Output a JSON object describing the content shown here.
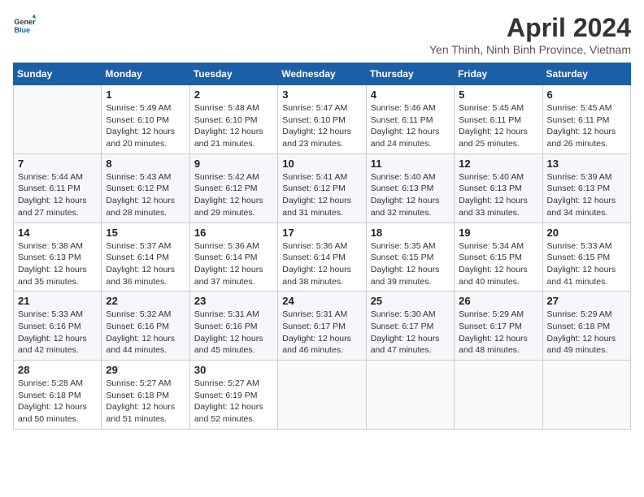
{
  "header": {
    "logo_line1": "General",
    "logo_line2": "Blue",
    "title": "April 2024",
    "location": "Yen Thinh, Ninh Binh Province, Vietnam"
  },
  "weekdays": [
    "Sunday",
    "Monday",
    "Tuesday",
    "Wednesday",
    "Thursday",
    "Friday",
    "Saturday"
  ],
  "weeks": [
    [
      {
        "day": "",
        "info": ""
      },
      {
        "day": "1",
        "info": "Sunrise: 5:49 AM\nSunset: 6:10 PM\nDaylight: 12 hours\nand 20 minutes."
      },
      {
        "day": "2",
        "info": "Sunrise: 5:48 AM\nSunset: 6:10 PM\nDaylight: 12 hours\nand 21 minutes."
      },
      {
        "day": "3",
        "info": "Sunrise: 5:47 AM\nSunset: 6:10 PM\nDaylight: 12 hours\nand 23 minutes."
      },
      {
        "day": "4",
        "info": "Sunrise: 5:46 AM\nSunset: 6:11 PM\nDaylight: 12 hours\nand 24 minutes."
      },
      {
        "day": "5",
        "info": "Sunrise: 5:45 AM\nSunset: 6:11 PM\nDaylight: 12 hours\nand 25 minutes."
      },
      {
        "day": "6",
        "info": "Sunrise: 5:45 AM\nSunset: 6:11 PM\nDaylight: 12 hours\nand 26 minutes."
      }
    ],
    [
      {
        "day": "7",
        "info": "Sunrise: 5:44 AM\nSunset: 6:11 PM\nDaylight: 12 hours\nand 27 minutes."
      },
      {
        "day": "8",
        "info": "Sunrise: 5:43 AM\nSunset: 6:12 PM\nDaylight: 12 hours\nand 28 minutes."
      },
      {
        "day": "9",
        "info": "Sunrise: 5:42 AM\nSunset: 6:12 PM\nDaylight: 12 hours\nand 29 minutes."
      },
      {
        "day": "10",
        "info": "Sunrise: 5:41 AM\nSunset: 6:12 PM\nDaylight: 12 hours\nand 31 minutes."
      },
      {
        "day": "11",
        "info": "Sunrise: 5:40 AM\nSunset: 6:13 PM\nDaylight: 12 hours\nand 32 minutes."
      },
      {
        "day": "12",
        "info": "Sunrise: 5:40 AM\nSunset: 6:13 PM\nDaylight: 12 hours\nand 33 minutes."
      },
      {
        "day": "13",
        "info": "Sunrise: 5:39 AM\nSunset: 6:13 PM\nDaylight: 12 hours\nand 34 minutes."
      }
    ],
    [
      {
        "day": "14",
        "info": "Sunrise: 5:38 AM\nSunset: 6:13 PM\nDaylight: 12 hours\nand 35 minutes."
      },
      {
        "day": "15",
        "info": "Sunrise: 5:37 AM\nSunset: 6:14 PM\nDaylight: 12 hours\nand 36 minutes."
      },
      {
        "day": "16",
        "info": "Sunrise: 5:36 AM\nSunset: 6:14 PM\nDaylight: 12 hours\nand 37 minutes."
      },
      {
        "day": "17",
        "info": "Sunrise: 5:36 AM\nSunset: 6:14 PM\nDaylight: 12 hours\nand 38 minutes."
      },
      {
        "day": "18",
        "info": "Sunrise: 5:35 AM\nSunset: 6:15 PM\nDaylight: 12 hours\nand 39 minutes."
      },
      {
        "day": "19",
        "info": "Sunrise: 5:34 AM\nSunset: 6:15 PM\nDaylight: 12 hours\nand 40 minutes."
      },
      {
        "day": "20",
        "info": "Sunrise: 5:33 AM\nSunset: 6:15 PM\nDaylight: 12 hours\nand 41 minutes."
      }
    ],
    [
      {
        "day": "21",
        "info": "Sunrise: 5:33 AM\nSunset: 6:16 PM\nDaylight: 12 hours\nand 42 minutes."
      },
      {
        "day": "22",
        "info": "Sunrise: 5:32 AM\nSunset: 6:16 PM\nDaylight: 12 hours\nand 44 minutes."
      },
      {
        "day": "23",
        "info": "Sunrise: 5:31 AM\nSunset: 6:16 PM\nDaylight: 12 hours\nand 45 minutes."
      },
      {
        "day": "24",
        "info": "Sunrise: 5:31 AM\nSunset: 6:17 PM\nDaylight: 12 hours\nand 46 minutes."
      },
      {
        "day": "25",
        "info": "Sunrise: 5:30 AM\nSunset: 6:17 PM\nDaylight: 12 hours\nand 47 minutes."
      },
      {
        "day": "26",
        "info": "Sunrise: 5:29 AM\nSunset: 6:17 PM\nDaylight: 12 hours\nand 48 minutes."
      },
      {
        "day": "27",
        "info": "Sunrise: 5:29 AM\nSunset: 6:18 PM\nDaylight: 12 hours\nand 49 minutes."
      }
    ],
    [
      {
        "day": "28",
        "info": "Sunrise: 5:28 AM\nSunset: 6:18 PM\nDaylight: 12 hours\nand 50 minutes."
      },
      {
        "day": "29",
        "info": "Sunrise: 5:27 AM\nSunset: 6:18 PM\nDaylight: 12 hours\nand 51 minutes."
      },
      {
        "day": "30",
        "info": "Sunrise: 5:27 AM\nSunset: 6:19 PM\nDaylight: 12 hours\nand 52 minutes."
      },
      {
        "day": "",
        "info": ""
      },
      {
        "day": "",
        "info": ""
      },
      {
        "day": "",
        "info": ""
      },
      {
        "day": "",
        "info": ""
      }
    ]
  ]
}
